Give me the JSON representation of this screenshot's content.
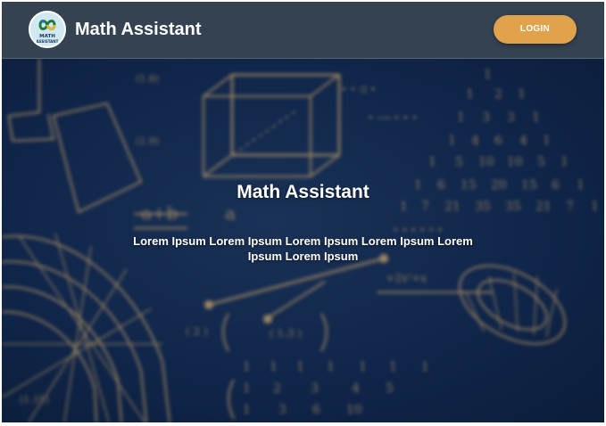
{
  "header": {
    "logo": {
      "line1": "MATH",
      "line2": "ASSISTANT"
    },
    "title": "Math Assistant",
    "login_label": "LOGIN"
  },
  "hero": {
    "title": "Math Assistant",
    "subtitle": "Lorem Ipsum Lorem Ipsum Lorem Ipsum Lorem Ipsum Lorem Ipsum Lorem Ipsum"
  },
  "colors": {
    "navbar": "#354252",
    "accent": "#e0a24b",
    "hero_background": "#10264a",
    "chalk": "#c9a36a"
  },
  "icons": {
    "logo": "infinity-logo-icon"
  }
}
